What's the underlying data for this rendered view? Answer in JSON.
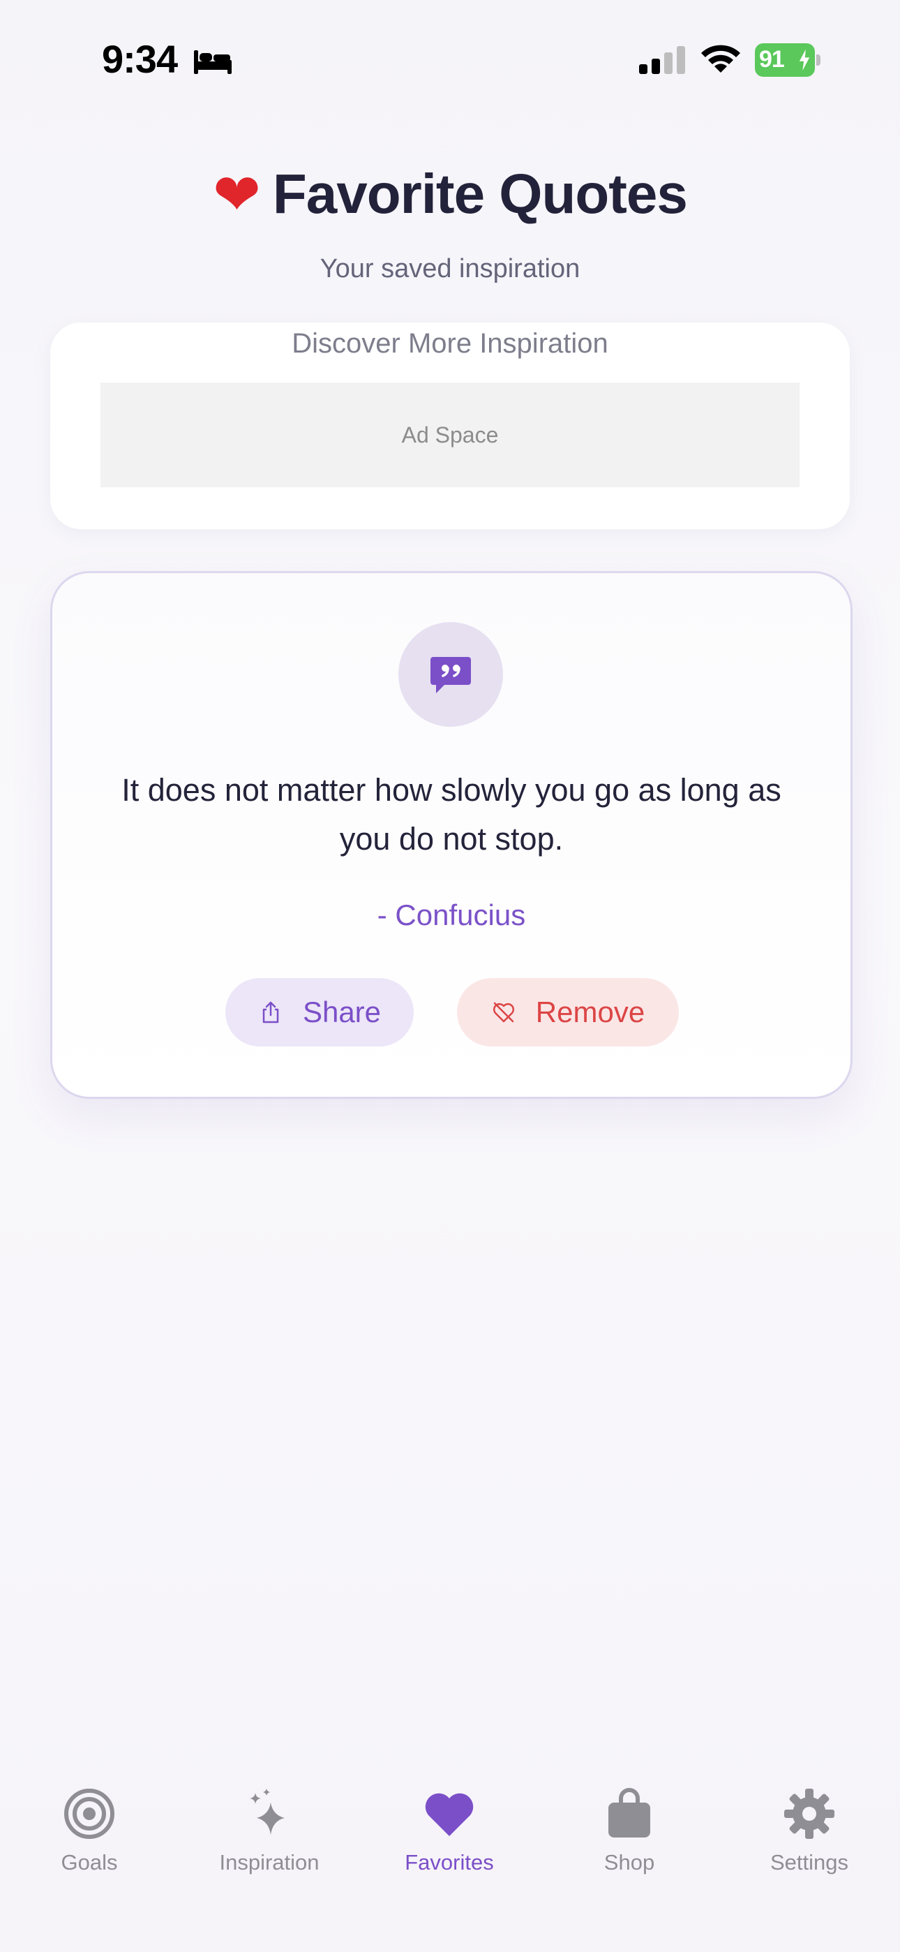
{
  "status_bar": {
    "time": "9:34",
    "battery": "91"
  },
  "header": {
    "title": "Favorite Quotes",
    "emoji": "❤️",
    "subtitle": "Your saved inspiration"
  },
  "ad": {
    "title": "Discover More Inspiration",
    "placeholder": "Ad Space"
  },
  "quote": {
    "text": "It does not matter how slowly you go as long as you do not stop.",
    "author": "- Confucius",
    "share_label": "Share",
    "remove_label": "Remove"
  },
  "tabs": [
    {
      "label": "Goals",
      "icon": "target-icon",
      "active": false
    },
    {
      "label": "Inspiration",
      "icon": "sparkles-icon",
      "active": false
    },
    {
      "label": "Favorites",
      "icon": "heart-icon",
      "active": true
    },
    {
      "label": "Shop",
      "icon": "shopping-bag-icon",
      "active": false
    },
    {
      "label": "Settings",
      "icon": "gear-icon",
      "active": false
    }
  ],
  "colors": {
    "accent": "#7b4fc8",
    "danger": "#dc4545",
    "inactive": "#8e8e94"
  }
}
